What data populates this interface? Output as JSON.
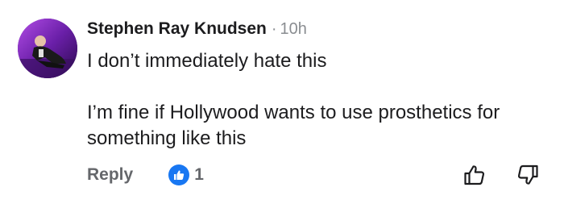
{
  "comment": {
    "author": "Stephen Ray Knudsen",
    "separator": "·",
    "timestamp": "10h",
    "lines": [
      "I don’t immediately hate this",
      "I’m fine if Hollywood wants to use prosthetics for something like this"
    ]
  },
  "actions": {
    "reply_label": "Reply",
    "reaction_count": "1",
    "reaction_icon": "like-icon",
    "upvote_icon": "thumbs-up-icon",
    "downvote_icon": "thumbs-down-icon"
  },
  "colors": {
    "text": "#1c1c1e",
    "muted": "#65676b",
    "timestamp": "#8a8d91",
    "like_blue": "#1877f2"
  }
}
